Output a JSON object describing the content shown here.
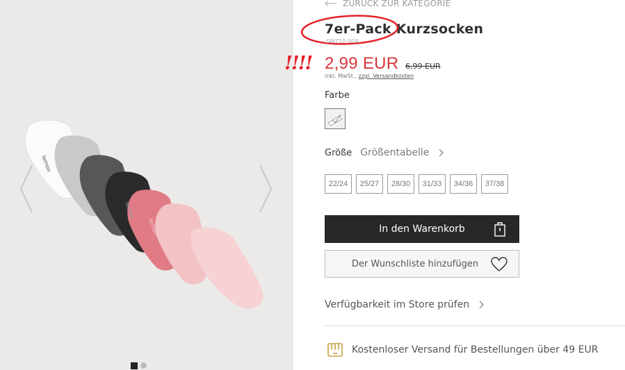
{
  "gallery": {
    "prev_icon": "chevron-left-icon",
    "next_icon": "chevron-right-icon",
    "dots": [
      "active",
      "inactive"
    ]
  },
  "product": {
    "back_label": "ZURÜCK ZUR KATEGORIE",
    "title": "7er-Pack Kurzsocken",
    "sku": "SW710-00X",
    "annotation": "!!!!",
    "price": "2,99 EUR",
    "old_price": "6,99 EUR",
    "vat_prefix": "inkl. MwSt.,",
    "vat_link": "zzgl. Versandkosten",
    "color_label": "Farbe",
    "size_label": "Größe",
    "size_table": "Größentabelle",
    "sizes": [
      "22/24",
      "25/27",
      "28/30",
      "31/33",
      "34/36",
      "37/38"
    ],
    "add_to_cart": "In den Warenkorb",
    "wishlist": "Der Wunschliste hinzufügen",
    "store_check": "Verfügbarkeit im Store prüfen",
    "shipping": "Kostenloser Versand für Bestellungen über 49 EUR"
  },
  "colors": {
    "price": "#d7343a",
    "annotation": "#e3222a",
    "cart_button": "#282828",
    "shipping_icon": "#c9a24a"
  }
}
